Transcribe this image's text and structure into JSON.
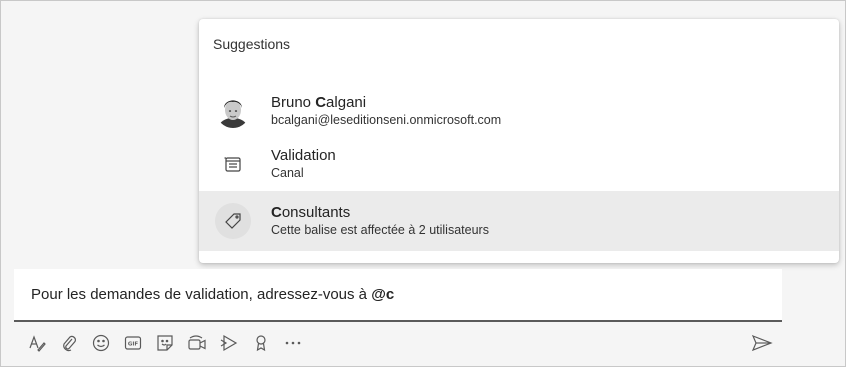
{
  "suggestions": {
    "title": "Suggestions",
    "items": [
      {
        "name_match": "",
        "name_pre": "Bruno ",
        "name_bold": "C",
        "name_post": "algani",
        "sub": "bcalgani@leseditionseni.onmicrosoft.com",
        "icon": "avatar-photo"
      },
      {
        "name_pre": "Validation",
        "sub": "Canal",
        "icon": "channel-icon"
      },
      {
        "name_bold": "C",
        "name_post": "onsultants",
        "sub": "Cette balise est affectée à 2 utilisateurs",
        "icon": "tag-icon",
        "selected": true
      }
    ]
  },
  "compose": {
    "text": "Pour les demandes de validation, adressez-vous à ",
    "mention": "@c"
  },
  "toolbar": {
    "buttons": [
      "format-icon",
      "attach-icon",
      "emoji-icon",
      "gif-icon",
      "sticker-icon",
      "meet-now-icon",
      "stream-icon",
      "praise-icon",
      "more-options-icon",
      "send-icon"
    ]
  }
}
